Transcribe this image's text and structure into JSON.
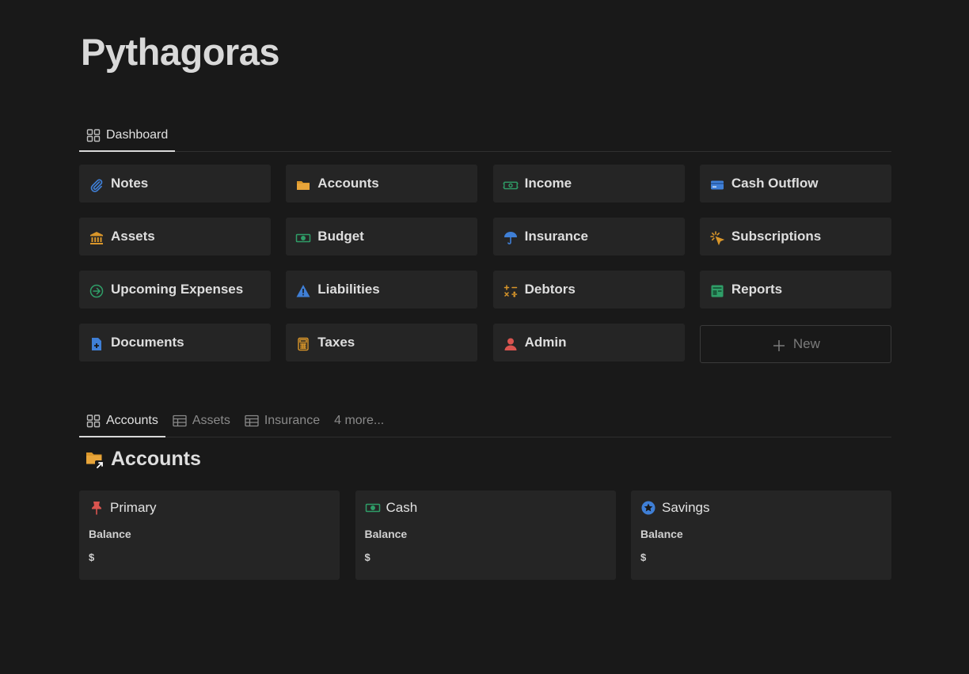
{
  "page": {
    "title": "Pythagoras"
  },
  "top_tabs": [
    {
      "label": "Dashboard",
      "active": true,
      "icon": "gallery-icon"
    }
  ],
  "tiles": [
    {
      "label": "Notes",
      "icon": "paperclip-icon",
      "color": "#3f7fd6"
    },
    {
      "label": "Accounts",
      "icon": "folder-icon",
      "color": "#d9962a"
    },
    {
      "label": "Income",
      "icon": "money-icon",
      "color": "#2f9e68"
    },
    {
      "label": "Cash Outflow",
      "icon": "credit-card-icon",
      "color": "#3f7fd6"
    },
    {
      "label": "Assets",
      "icon": "bank-icon",
      "color": "#d9962a"
    },
    {
      "label": "Budget",
      "icon": "banknote-icon",
      "color": "#2f9e68"
    },
    {
      "label": "Insurance",
      "icon": "umbrella-icon",
      "color": "#3f7fd6"
    },
    {
      "label": "Subscriptions",
      "icon": "click-icon",
      "color": "#d9962a"
    },
    {
      "label": "Upcoming Expenses",
      "icon": "arrow-circle-icon",
      "color": "#2f9e68"
    },
    {
      "label": "Liabilities",
      "icon": "warning-icon",
      "color": "#3f7fd6"
    },
    {
      "label": "Debtors",
      "icon": "math-icon",
      "color": "#d9962a"
    },
    {
      "label": "Reports",
      "icon": "report-icon",
      "color": "#2f9e68"
    },
    {
      "label": "Documents",
      "icon": "document-add-icon",
      "color": "#3f7fd6"
    },
    {
      "label": "Taxes",
      "icon": "calculator-icon",
      "color": "#d9962a"
    },
    {
      "label": "Admin",
      "icon": "person-icon",
      "color": "#d9544f"
    }
  ],
  "new_tile": {
    "label": "New",
    "icon": "plus-icon"
  },
  "view_tabs": [
    {
      "label": "Accounts",
      "active": true,
      "icon": "gallery-icon"
    },
    {
      "label": "Assets",
      "active": false,
      "icon": "table-icon"
    },
    {
      "label": "Insurance",
      "active": false,
      "icon": "table-icon"
    },
    {
      "label": "4 more...",
      "active": false
    }
  ],
  "section": {
    "title": "Accounts",
    "icon": "folder-link-icon"
  },
  "cards": [
    {
      "name": "Primary",
      "icon": "pin-icon",
      "color": "#d9544f",
      "prop_label": "Balance",
      "prop_value": "$"
    },
    {
      "name": "Cash",
      "icon": "banknote-icon",
      "color": "#2f9e68",
      "prop_label": "Balance",
      "prop_value": "$"
    },
    {
      "name": "Savings",
      "icon": "star-circle-icon",
      "color": "#3f7fd6",
      "prop_label": "Balance",
      "prop_value": "$"
    }
  ]
}
